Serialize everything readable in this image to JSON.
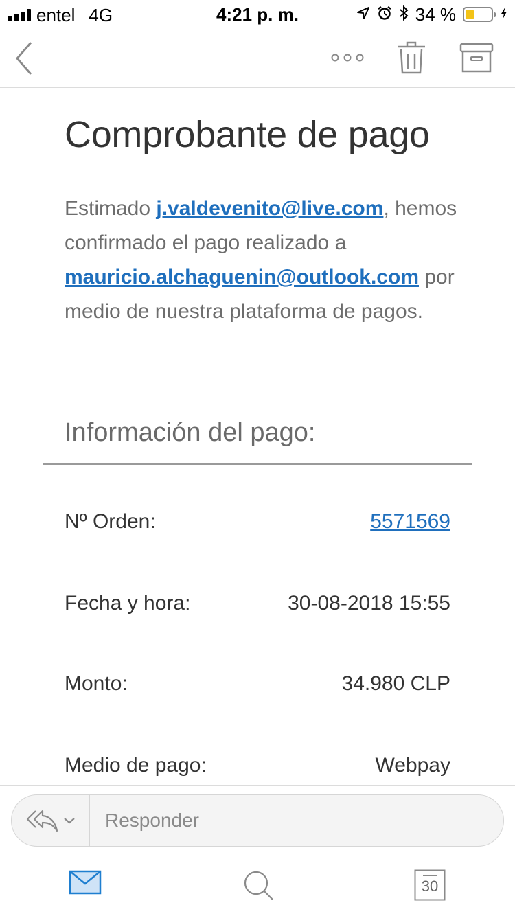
{
  "status_bar": {
    "carrier": "entel",
    "network": "4G",
    "time": "4:21 p. m.",
    "battery_percent_label": "34 %",
    "battery_level": 0.34,
    "battery_color": "#f3c318",
    "icons": [
      "signal-icon",
      "location-arrow-icon",
      "alarm-icon",
      "bluetooth-icon",
      "battery-icon",
      "charging-icon"
    ]
  },
  "toolbar": {
    "icons": [
      "chevron-left-icon",
      "more-icon",
      "trash-icon",
      "archive-icon"
    ]
  },
  "message": {
    "subject": "Comprobante de pago",
    "greeting": "Estimado ",
    "sender_email": "j.valdevenito@live.com",
    "comma": ",",
    "body_1": "hemos confirmado el pago realizado a",
    "recipient_email": "mauricio.alchaguenin@outlook.com",
    "body_2": "por medio de nuestra plataforma de pagos.",
    "info_title": "Información del pago:",
    "rows": [
      {
        "label": "Nº Orden:",
        "value": "5571569"
      },
      {
        "label": "Fecha y hora:",
        "value": "30-08-2018 15:55"
      },
      {
        "label": "Monto:",
        "value": "34.980 CLP"
      },
      {
        "label": "Medio de pago:",
        "value": "Webpay"
      }
    ]
  },
  "reply": {
    "placeholder": "Responder",
    "icons": [
      "reply-all-icon",
      "chevron-down-icon"
    ]
  },
  "tab_bar": {
    "calendar_day": "30",
    "icons": [
      "mail-icon",
      "search-icon",
      "calendar-icon"
    ]
  },
  "colors": {
    "link": "#1f6fbd",
    "accent": "#1f7fd0"
  }
}
